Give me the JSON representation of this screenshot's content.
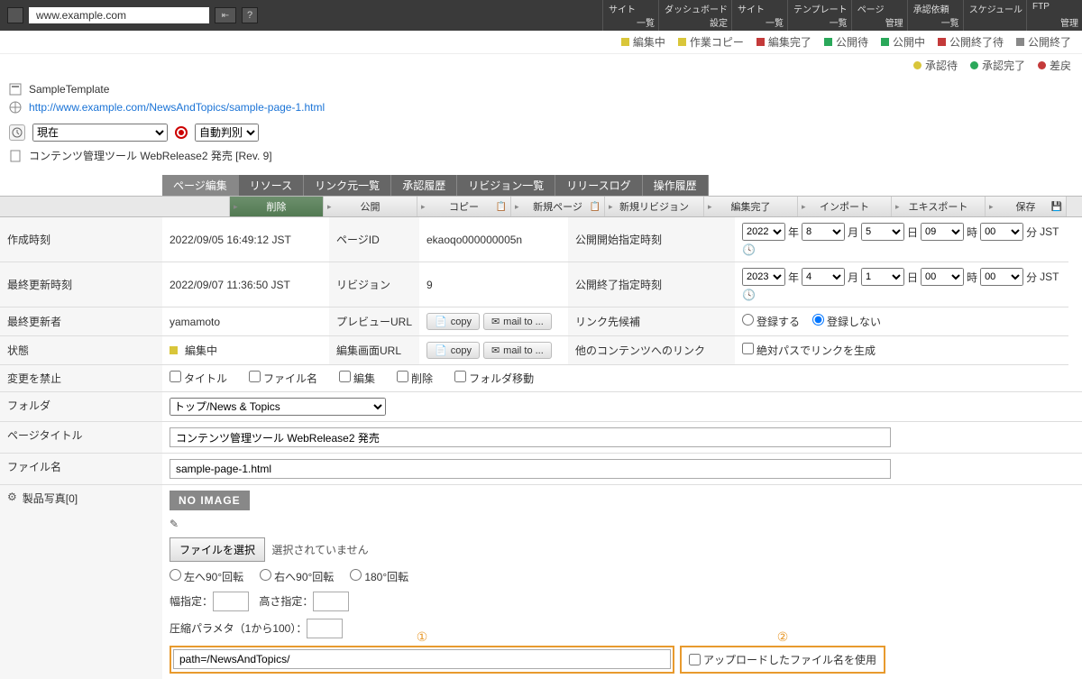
{
  "topbar": {
    "url": "www.example.com",
    "nav": [
      {
        "main": "サイト",
        "sub": "一覧"
      },
      {
        "main": "ダッシュボード",
        "sub": "設定"
      },
      {
        "main": "サイト",
        "sub": "一覧"
      },
      {
        "main": "テンプレート",
        "sub": "一覧"
      },
      {
        "main": "ページ",
        "sub": "管理"
      },
      {
        "main": "承認依頼",
        "sub": "一覧"
      },
      {
        "main": "スケジュール",
        "sub": ""
      },
      {
        "main": "FTP",
        "sub": "管理"
      }
    ]
  },
  "status1": [
    {
      "color": "#d9c63a",
      "label": "編集中"
    },
    {
      "color": "#d9c63a",
      "label": "作業コピー"
    },
    {
      "color": "#c43a3a",
      "label": "編集完了"
    },
    {
      "color": "#2aa85a",
      "label": "公開待"
    },
    {
      "color": "#2aa85a",
      "label": "公開中"
    },
    {
      "color": "#c43a3a",
      "label": "公開終了待"
    },
    {
      "color": "#888",
      "label": "公開終了"
    }
  ],
  "status2": [
    {
      "color": "#d9c63a",
      "label": "承認待"
    },
    {
      "color": "#2aa85a",
      "label": "承認完了"
    },
    {
      "color": "#c43a3a",
      "label": "差戻"
    }
  ],
  "meta": {
    "template": "SampleTemplate",
    "page_url": "http://www.example.com/NewsAndTopics/sample-page-1.html",
    "content_title": "コンテンツ管理ツール WebRelease2 発売 [Rev. 9]"
  },
  "controls": {
    "when": "現在",
    "detect": "自動判別"
  },
  "tabs": [
    "ページ編集",
    "リソース",
    "リンク元一覧",
    "承認履歴",
    "リビジョン一覧",
    "リリースログ",
    "操作履歴"
  ],
  "actions": [
    "削除",
    "公開",
    "コピー",
    "新規ページ",
    "新規リビジョン",
    "編集完了",
    "インポート",
    "エキスポート",
    "保存"
  ],
  "grid": {
    "created_label": "作成時刻",
    "created": "2022/09/05 16:49:12 JST",
    "updated_label": "最終更新時刻",
    "updated": "2022/09/07 11:36:50 JST",
    "updater_label": "最終更新者",
    "updater": "yamamoto",
    "state_label": "状態",
    "state": "編集中",
    "pageid_label": "ページID",
    "pageid": "ekaoqo000000005n",
    "rev_label": "リビジョン",
    "rev": "9",
    "preview_label": "プレビューURL",
    "editurl_label": "編集画面URL",
    "copy_btn": "copy",
    "mailto_btn": "mail to ...",
    "pubstart_label": "公開開始指定時刻",
    "pubend_label": "公開終了指定時刻",
    "linkcand_label": "リンク先候補",
    "otherlink_label": "他のコンテンツへのリンク",
    "reg_yes": "登録する",
    "reg_no": "登録しない",
    "abspath": "絶対パスでリンクを生成",
    "start": {
      "y": "2022",
      "m": "8",
      "d": "5",
      "h": "09",
      "mi": "00"
    },
    "end": {
      "y": "2023",
      "m": "4",
      "d": "1",
      "h": "00",
      "mi": "00"
    },
    "date_units": {
      "y": "年",
      "m": "月",
      "d": "日",
      "h": "時",
      "mi": "分",
      "tz": "JST"
    }
  },
  "lock": {
    "label": "変更を禁止",
    "opts": [
      "タイトル",
      "ファイル名",
      "編集",
      "削除",
      "フォルダ移動"
    ]
  },
  "folder": {
    "label": "フォルダ",
    "value": "トップ/News & Topics"
  },
  "pagetitle": {
    "label": "ページタイトル",
    "value": "コンテンツ管理ツール WebRelease2 発売"
  },
  "filename": {
    "label": "ファイル名",
    "value": "sample-page-1.html"
  },
  "photo": {
    "label": "製品写真[0]",
    "noimage": "NO IMAGE",
    "choose": "ファイルを選択",
    "none": "選択されていません",
    "rot": [
      "左へ90°回転",
      "右へ90°回転",
      "180°回転"
    ],
    "w": "幅指定：",
    "h": "高さ指定：",
    "q": "圧縮パラメタ（1から100）：",
    "path": "path=/NewsAndTopics/",
    "use_uploaded": "アップロードしたファイル名を使用",
    "annot1": "①",
    "annot2": "②"
  }
}
